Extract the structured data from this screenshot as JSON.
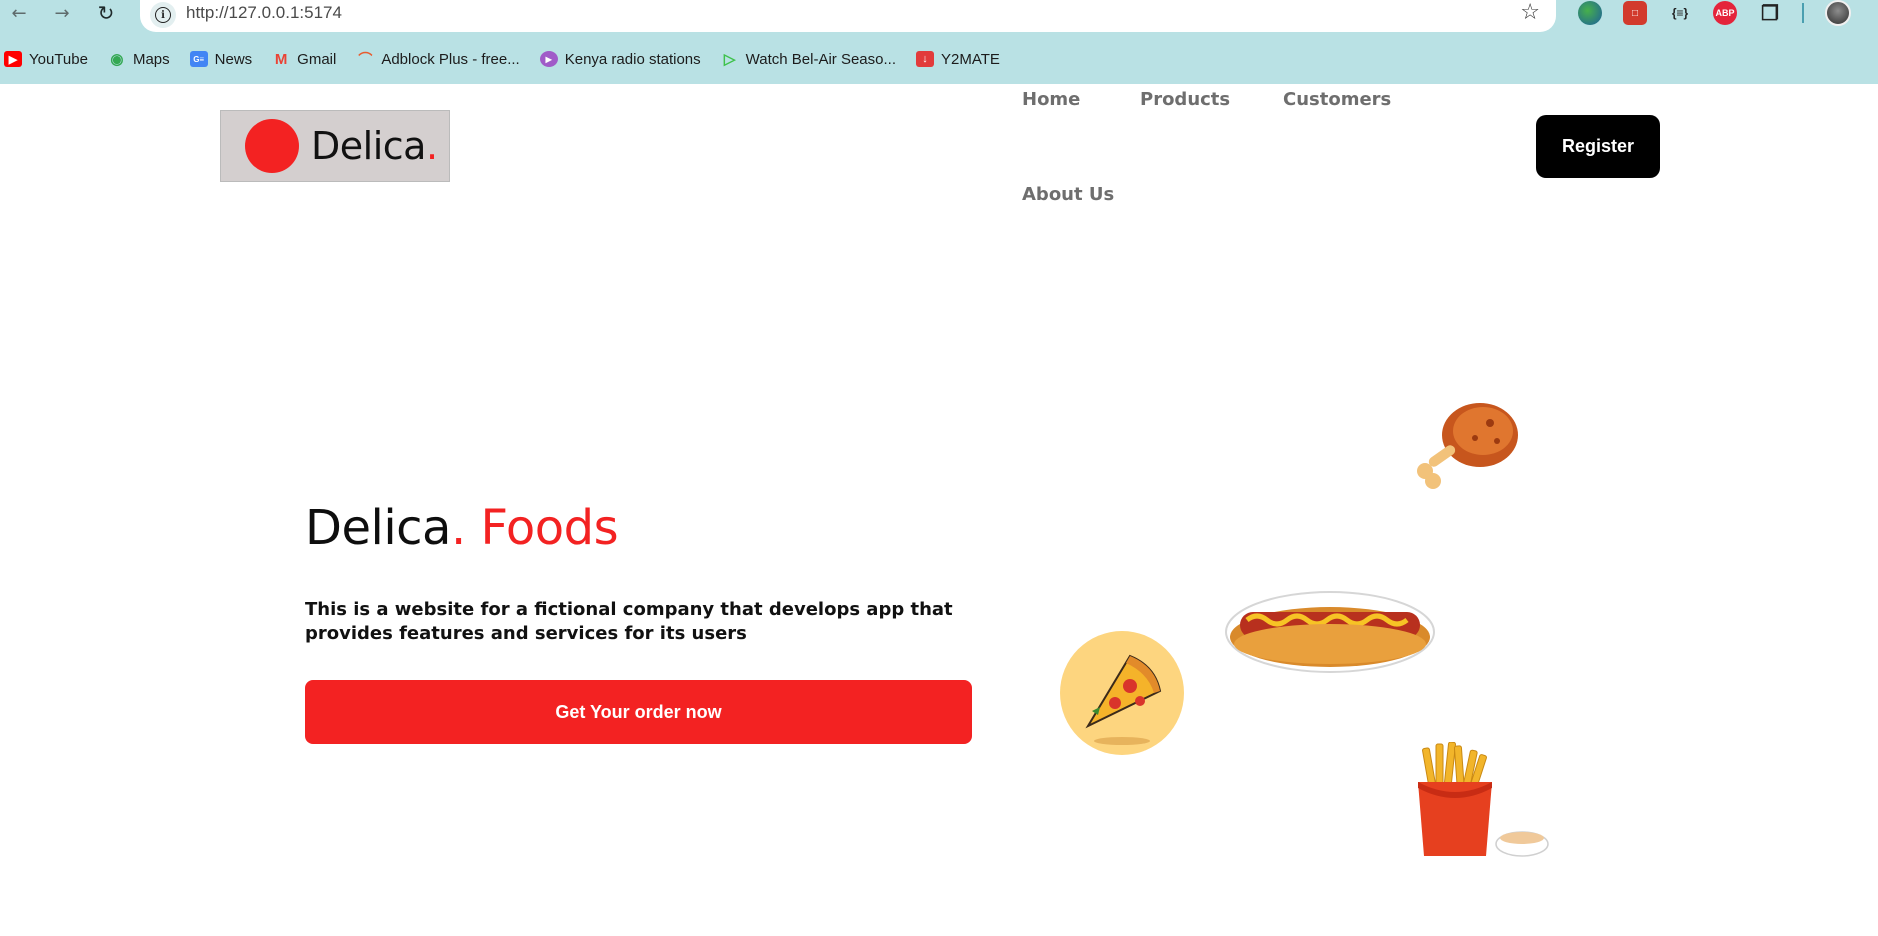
{
  "browser": {
    "url": "http://127.0.0.1:5174",
    "bookmarks": [
      {
        "label": "YouTube",
        "icon": "youtube-icon",
        "color": "#ff0000"
      },
      {
        "label": "Maps",
        "icon": "maps-icon",
        "color": "#34a853"
      },
      {
        "label": "News",
        "icon": "news-icon",
        "color": "#4285f4"
      },
      {
        "label": "Gmail",
        "icon": "gmail-icon",
        "color": "#ea4335"
      },
      {
        "label": "Adblock Plus - free...",
        "icon": "rainbow-icon",
        "color": "#e85c2f"
      },
      {
        "label": "Kenya radio stations",
        "icon": "radio-icon",
        "color": "#a05bc8"
      },
      {
        "label": "Watch Bel-Air Seaso...",
        "icon": "play-icon",
        "color": "#3ec24b"
      },
      {
        "label": "Y2MATE",
        "icon": "download-icon",
        "color": "#e23b3b"
      }
    ]
  },
  "header": {
    "logo_text": "Delica",
    "logo_dot": ".",
    "nav": [
      {
        "label": "Home"
      },
      {
        "label": "Products"
      },
      {
        "label": "Customers"
      },
      {
        "label": "About Us"
      }
    ],
    "register_label": "Register"
  },
  "hero": {
    "title_main": "Delica",
    "title_dot": ".",
    "title_accent": " Foods",
    "description": "This is a website for a fictional company that develops app that provides features and services for its users",
    "cta_label": "Get Your order now"
  },
  "colors": {
    "accent": "#f32222",
    "chrome_bg": "#b9e1e4",
    "logo_bg": "#d4cfcf",
    "nav_text": "#6e6e6e"
  }
}
